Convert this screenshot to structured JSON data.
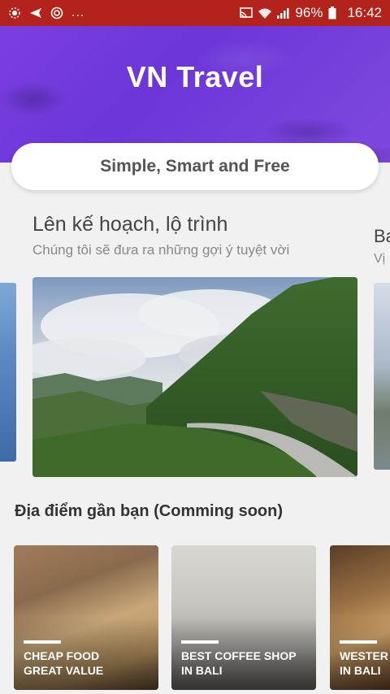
{
  "status_bar": {
    "dots": "...",
    "battery": "96%",
    "time": "16:42"
  },
  "header": {
    "title": "VN Travel",
    "tagline": "Simple, Smart and Free"
  },
  "carousel": {
    "current": {
      "title": "Lên kế hoạch, lộ trình",
      "subtitle": "Chúng tôi sẽ đưa ra những gợi ý tuyệt vời"
    },
    "next": {
      "title": "Ba",
      "subtitle": "Vị"
    }
  },
  "nearby": {
    "title": "Địa điểm gần bạn (Comming soon)",
    "cards": [
      {
        "label": "CHEAP FOOD\nGREAT VALUE"
      },
      {
        "label": "BEST COFFEE SHOP\nIN BALI"
      },
      {
        "label": "WESTER\nIN BALI"
      }
    ]
  }
}
